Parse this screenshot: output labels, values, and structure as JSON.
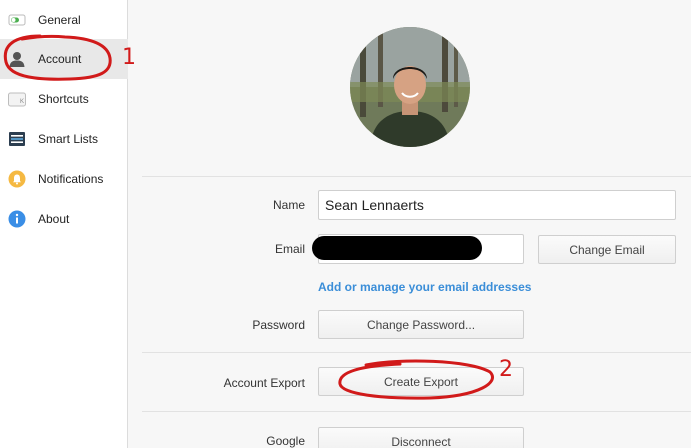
{
  "sidebar": {
    "items": [
      {
        "label": "General",
        "icon": "toggle-icon"
      },
      {
        "label": "Account",
        "icon": "user-icon",
        "active": true
      },
      {
        "label": "Shortcuts",
        "icon": "keyboard-icon"
      },
      {
        "label": "Smart Lists",
        "icon": "list-icon"
      },
      {
        "label": "Notifications",
        "icon": "bell-icon"
      },
      {
        "label": "About",
        "icon": "info-icon"
      }
    ]
  },
  "account": {
    "name_label": "Name",
    "name_value": "Sean Lennaerts",
    "email_label": "Email",
    "change_email": "Change Email",
    "manage_emails_link": "Add or manage your email addresses",
    "password_label": "Password",
    "change_password": "Change Password...",
    "export_label": "Account Export",
    "create_export": "Create Export",
    "google_label": "Google",
    "disconnect": "Disconnect"
  },
  "annotations": {
    "step1": "1",
    "step2": "2",
    "color": "#d11a1a"
  },
  "colors": {
    "link": "#3b8ed8",
    "active_bg": "#e8e8e8"
  }
}
